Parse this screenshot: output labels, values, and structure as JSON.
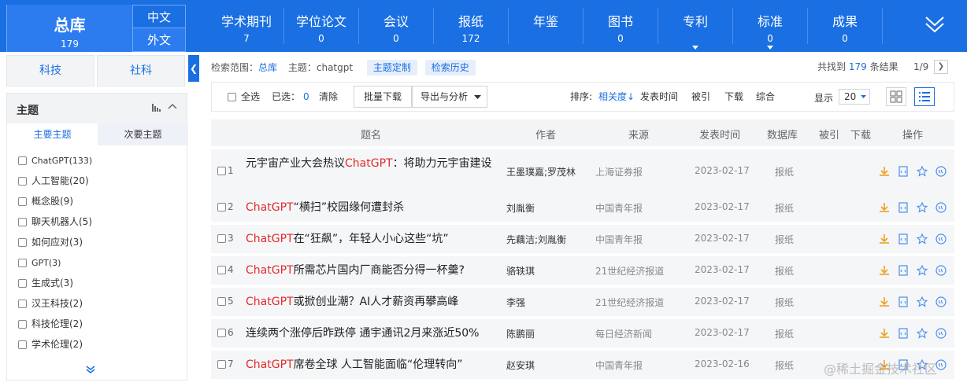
{
  "topnav": {
    "zongku": {
      "label": "总库",
      "count": "179"
    },
    "lang_zh": "中文",
    "lang_wai": "外文",
    "items": [
      {
        "label": "学术期刊",
        "count": "7"
      },
      {
        "label": "学位论文",
        "count": "0"
      },
      {
        "label": "会议",
        "count": "0"
      },
      {
        "label": "报纸",
        "count": "172"
      },
      {
        "label": "年鉴",
        "count": ""
      },
      {
        "label": "图书",
        "count": "0"
      },
      {
        "label": "专利",
        "count": ""
      },
      {
        "label": "标准",
        "count": "0"
      },
      {
        "label": "成果",
        "count": "0"
      }
    ]
  },
  "sidebar": {
    "tab_keji": "科技",
    "tab_sheke": "社科",
    "theme_title": "主题",
    "subtab_main": "主要主题",
    "subtab_sub": "次要主题",
    "topics": [
      "ChatGPT(133)",
      "人工智能(20)",
      "概念股(9)",
      "聊天机器人(5)",
      "如何应对(3)",
      "GPT(3)",
      "生成式(3)",
      "汉王科技(2)",
      "科技伦理(2)",
      "学术伦理(2)"
    ]
  },
  "search": {
    "scope_label": "检索范围：",
    "scope_value": "总库",
    "topic_label": "主题：",
    "topic_value": "chatgpt",
    "custom_btn": "主题定制",
    "history_btn": "检索历史",
    "found_prefix": "共找到",
    "found_count": "179",
    "found_suffix": "条结果",
    "page": "1/9"
  },
  "toolbar": {
    "select_all": "全选",
    "selected_label": "已选：",
    "selected_count": "0",
    "clear": "清除",
    "bulk_download": "批量下载",
    "export": "导出与分析",
    "sort_label": "排序:",
    "sort_relevance": "相关度",
    "sort_date": "发表时间",
    "sort_cited": "被引",
    "sort_download": "下载",
    "sort_composite": "综合",
    "display_label": "显示",
    "display_value": "20"
  },
  "table": {
    "headers": {
      "title": "题名",
      "author": "作者",
      "source": "来源",
      "date": "发表时间",
      "database": "数据库",
      "cited": "被引",
      "download": "下载",
      "ops": "操作"
    },
    "rows": [
      {
        "no": "1",
        "pre": "元宇宙产业大会热议",
        "hl": "ChatGPT",
        "post": "：将助力元宇宙建设",
        "author": "王墨璞嘉;罗茂林",
        "source": "上海证券报",
        "date": "2023-02-17",
        "db": "报纸"
      },
      {
        "no": "2",
        "pre": "",
        "hl": "ChatGPT",
        "post": "“横扫”校园缘何遭封杀",
        "author": "刘胤衡",
        "source": "中国青年报",
        "date": "2023-02-17",
        "db": "报纸"
      },
      {
        "no": "3",
        "pre": "",
        "hl": "ChatGPT",
        "post": "在“狂飙”，年轻人小心这些“坑”",
        "author": "先藕洁;刘胤衡",
        "source": "中国青年报",
        "date": "2023-02-17",
        "db": "报纸"
      },
      {
        "no": "4",
        "pre": "",
        "hl": "ChatGPT",
        "post": "所需芯片国内厂商能否分得一杯羹?",
        "author": "骆轶琪",
        "source": "21世纪经济报道",
        "date": "2023-02-17",
        "db": "报纸"
      },
      {
        "no": "5",
        "pre": "",
        "hl": "ChatGPT",
        "post": "或掀创业潮？AI人才薪资再攀高峰",
        "author": "李强",
        "source": "21世纪经济报道",
        "date": "2023-02-17",
        "db": "报纸"
      },
      {
        "no": "6",
        "pre": "连续两个涨停后昨跌停 通宇通讯2月来涨近50%",
        "hl": "",
        "post": "",
        "author": "陈鹏丽",
        "source": "每日经济新闻",
        "date": "2023-02-17",
        "db": "报纸"
      },
      {
        "no": "7",
        "pre": "",
        "hl": "ChatGPT",
        "post": "席卷全球 人工智能面临“伦理转向”",
        "author": "赵安琪",
        "source": "中国青年报",
        "date": "2023-02-16",
        "db": "报纸"
      }
    ]
  },
  "watermark": "@稀土掘金技术社区",
  "colors": {
    "brand_blue": "#1a6fe2",
    "highlight_red": "#e22b2b",
    "icon_orange": "#f0a020"
  }
}
